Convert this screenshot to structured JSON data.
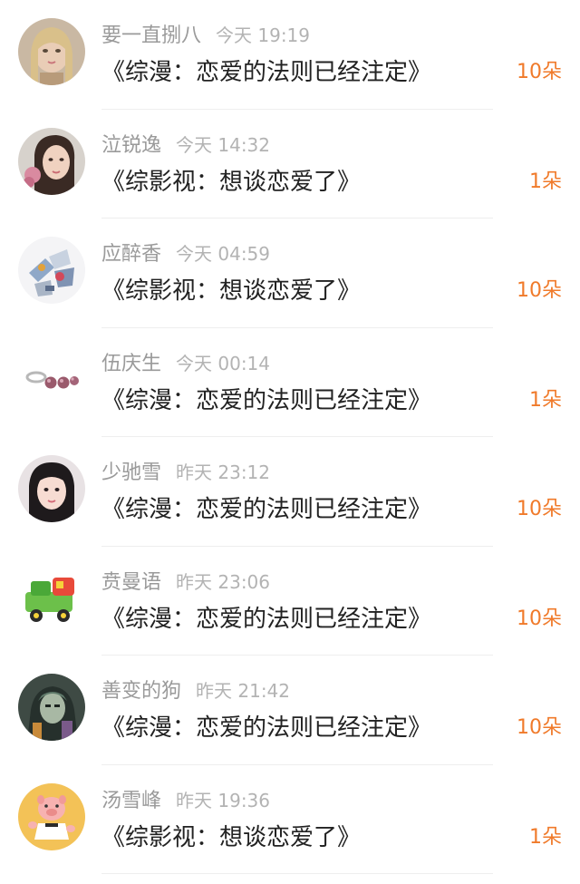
{
  "items": [
    {
      "username": "要一直捌八",
      "time": "今天 19:19",
      "title": "《综漫：恋爱的法则已经注定》",
      "gift": "10朵",
      "avatar_icon": "girl-portrait-avatar"
    },
    {
      "username": "泣锐逸",
      "time": "今天 14:32",
      "title": "《综影视：想谈恋爱了》",
      "gift": "1朵",
      "avatar_icon": "woman-portrait-avatar"
    },
    {
      "username": "应醉香",
      "time": "今天 04:59",
      "title": "《综影视：想谈恋爱了》",
      "gift": "10朵",
      "avatar_icon": "robot-toy-avatar"
    },
    {
      "username": "伍庆生",
      "time": "今天 00:14",
      "title": "《综漫：恋爱的法则已经注定》",
      "gift": "1朵",
      "avatar_icon": "pearl-ring-avatar"
    },
    {
      "username": "少驰雪",
      "time": "昨天 23:12",
      "title": "《综漫：恋爱的法则已经注定》",
      "gift": "10朵",
      "avatar_icon": "girl-selfie-avatar"
    },
    {
      "username": "贲曼语",
      "time": "昨天 23:06",
      "title": "《综漫：恋爱的法则已经注定》",
      "gift": "10朵",
      "avatar_icon": "toy-truck-avatar"
    },
    {
      "username": "善变的狗",
      "time": "昨天 21:42",
      "title": "《综漫：恋爱的法则已经注定》",
      "gift": "10朵",
      "avatar_icon": "anime-character-avatar"
    },
    {
      "username": "汤雪峰",
      "time": "昨天 19:36",
      "title": "《综影视：想谈恋爱了》",
      "gift": "1朵",
      "avatar_icon": "cartoon-pig-avatar"
    }
  ],
  "colors": {
    "gift": "#f07a2a",
    "username": "#9a9a9a",
    "time": "#b3b3b3",
    "title": "#222222",
    "divider": "#eeeeee"
  }
}
